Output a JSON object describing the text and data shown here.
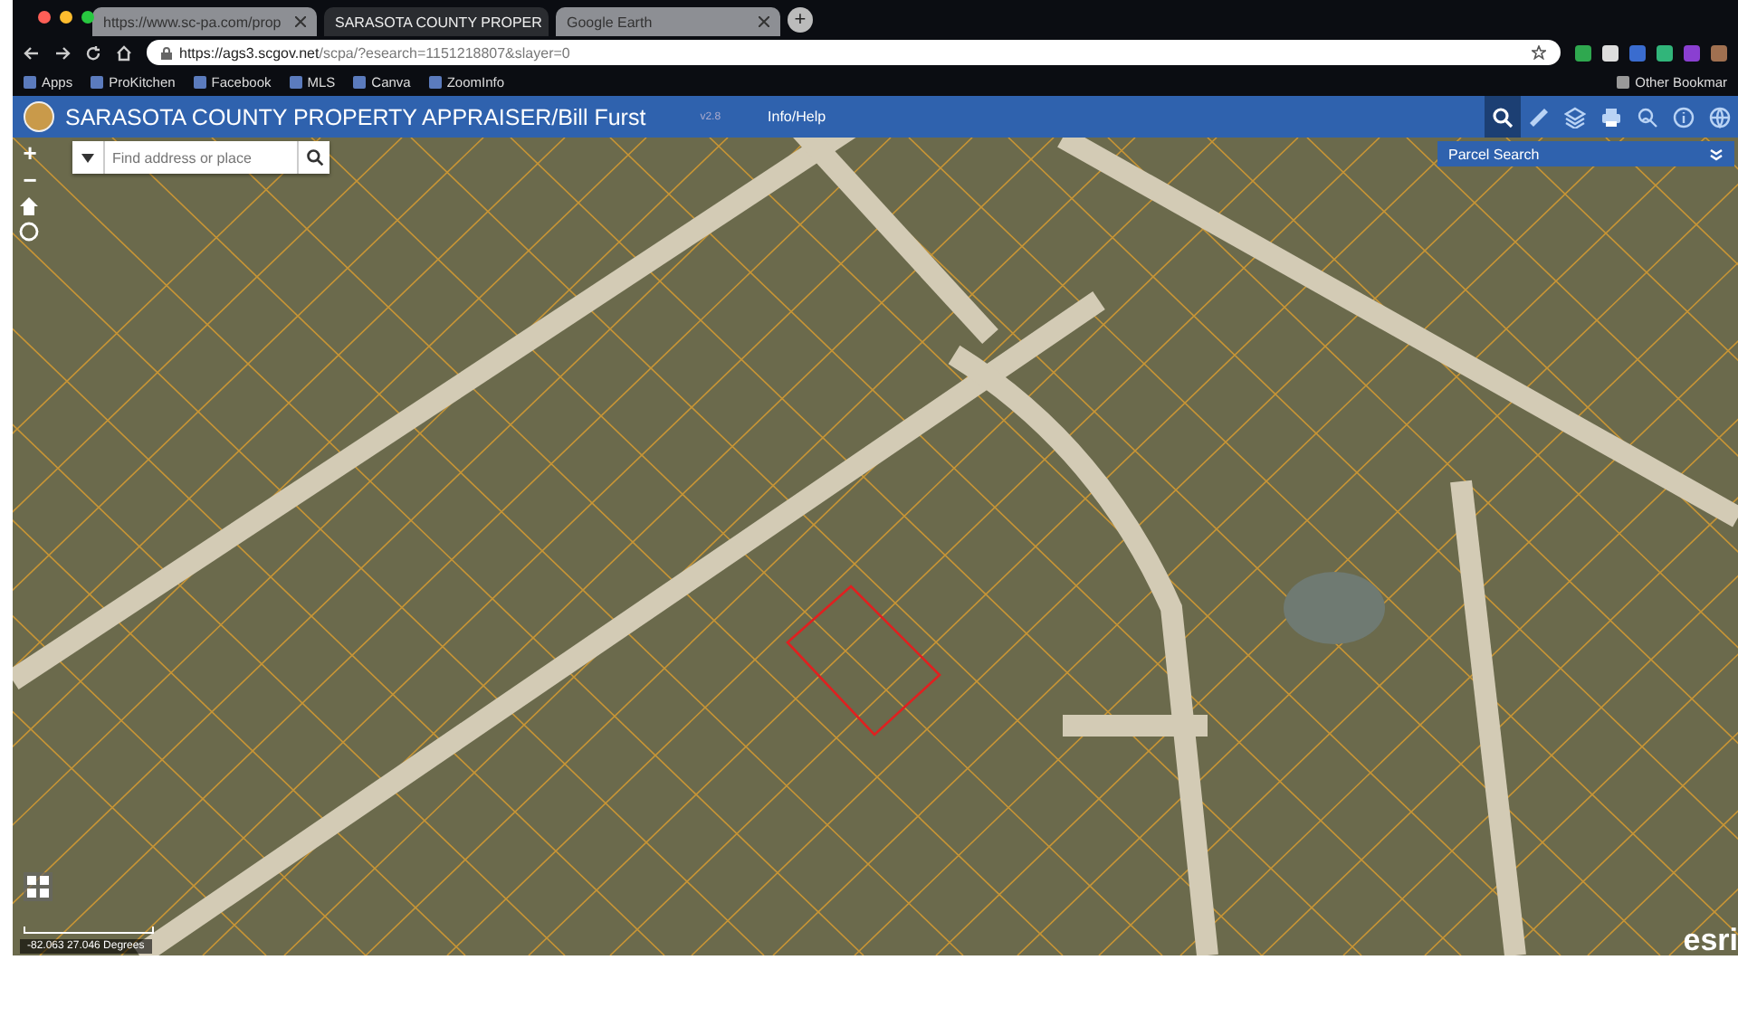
{
  "browser": {
    "tabs": [
      {
        "label": "https://www.sc-pa.com/prop",
        "selected": false
      },
      {
        "label": "SARASOTA COUNTY PROPER",
        "selected": true
      },
      {
        "label": "Google Earth",
        "selected": false
      }
    ],
    "new_tab": "+",
    "url": {
      "host": "https://ags3.scgov.net",
      "path": "/scpa/?esearch=1151218807&slayer=0"
    },
    "bookmarks": [
      {
        "label": "Apps"
      },
      {
        "label": "ProKitchen"
      },
      {
        "label": "Facebook"
      },
      {
        "label": "MLS"
      },
      {
        "label": "Canva"
      },
      {
        "label": "ZoomInfo"
      }
    ],
    "other_bookmarks": "Other Bookmar"
  },
  "app": {
    "title": "SARASOTA COUNTY PROPERTY APPRAISER/Bill Furst",
    "version": "v2.8",
    "menu": "Info/Help",
    "tools": [
      {
        "kind": "search",
        "selected": true
      },
      {
        "kind": "measure",
        "selected": false
      },
      {
        "kind": "layers",
        "selected": false
      },
      {
        "kind": "print",
        "selected": false
      },
      {
        "kind": "identify",
        "selected": false
      },
      {
        "kind": "info",
        "selected": false
      },
      {
        "kind": "basemap",
        "selected": false
      }
    ],
    "panel": {
      "title": "Parcel Search"
    },
    "map": {
      "search": {
        "placeholder": "Find address or place"
      },
      "zoom_in": "+",
      "zoom_out": "−",
      "coordinates": "-82.063 27.046 Degrees",
      "attribution": "esri"
    }
  }
}
